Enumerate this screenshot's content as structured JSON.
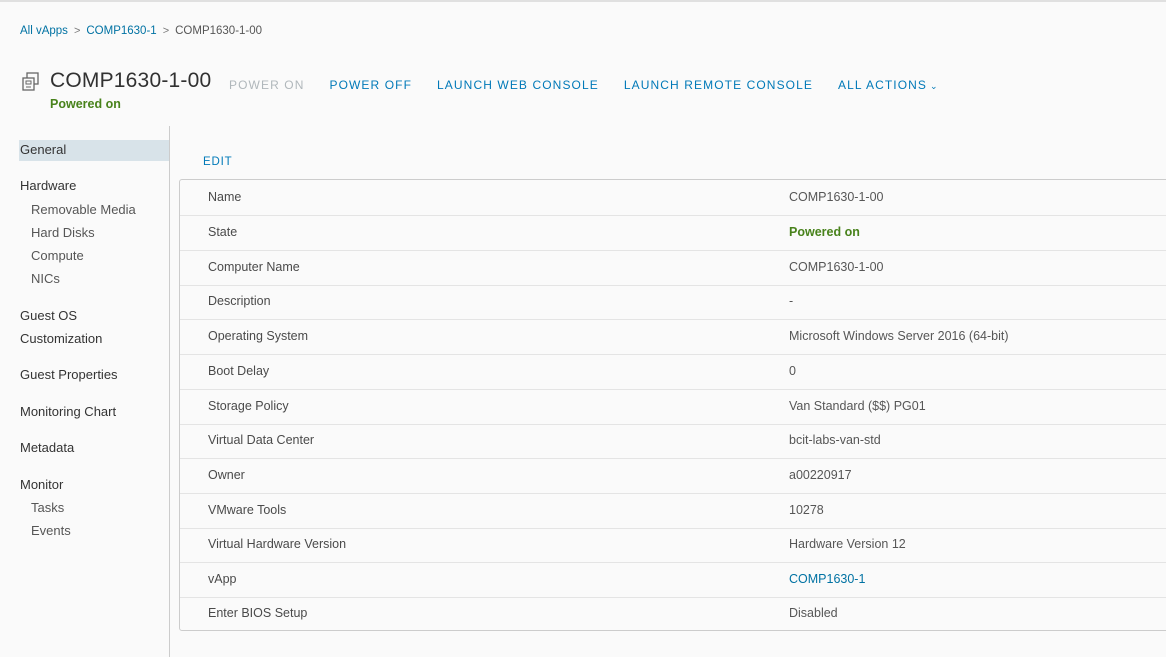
{
  "breadcrumb": {
    "items": [
      "All vApps",
      "COMP1630-1"
    ],
    "current": "COMP1630-1-00",
    "separator": ">"
  },
  "header": {
    "icon": "vm-icon",
    "title": "COMP1630-1-00",
    "status": "Powered on",
    "actions": [
      "POWER ON",
      "POWER OFF",
      "LAUNCH WEB CONSOLE",
      "LAUNCH REMOTE CONSOLE",
      "ALL ACTIONS"
    ]
  },
  "sidebar": {
    "general": "General",
    "hardware": "Hardware",
    "removable_media": "Removable Media",
    "hard_disks": "Hard Disks",
    "compute": "Compute",
    "nics": "NICs",
    "guest_os_1": "Guest OS",
    "guest_os_2": "Customization",
    "guest_properties": "Guest Properties",
    "monitoring_chart": "Monitoring Chart",
    "metadata": "Metadata",
    "monitor": "Monitor",
    "tasks": "Tasks",
    "events": "Events"
  },
  "main": {
    "edit_label": "EDIT",
    "rows": [
      {
        "key": "Name",
        "value": "COMP1630-1-00"
      },
      {
        "key": "State",
        "value": "Powered on"
      },
      {
        "key": "Computer Name",
        "value": "COMP1630-1-00"
      },
      {
        "key": "Description",
        "value": "-"
      },
      {
        "key": "Operating System",
        "value": "Microsoft Windows Server 2016 (64-bit)"
      },
      {
        "key": "Boot Delay",
        "value": "0"
      },
      {
        "key": "Storage Policy",
        "value": "Van Standard ($$) PG01"
      },
      {
        "key": "Virtual Data Center",
        "value": "bcit-labs-van-std"
      },
      {
        "key": "Owner",
        "value": "a00220917"
      },
      {
        "key": "VMware Tools",
        "value": "10278"
      },
      {
        "key": "Virtual Hardware Version",
        "value": "Hardware Version 12"
      },
      {
        "key": "vApp",
        "value": "COMP1630-1"
      },
      {
        "key": "Enter BIOS Setup",
        "value": "Disabled"
      }
    ]
  },
  "colors": {
    "link": "#0079b8",
    "status_green": "#48821b",
    "disabled": "#b0b7bb",
    "active_nav": "#d8e3e9"
  }
}
